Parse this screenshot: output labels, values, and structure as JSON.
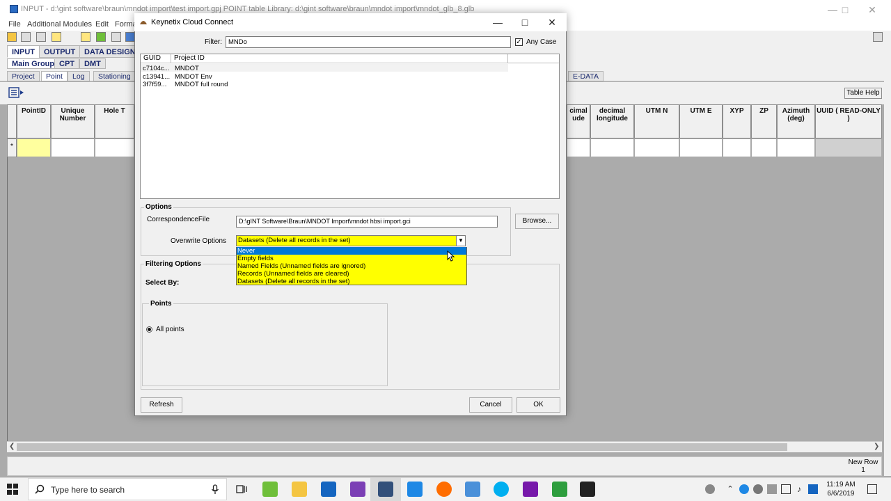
{
  "app": {
    "title": "INPUT - d:\\gint software\\braun\\mndot import\\test import.gpj  POINT table  Library: d:\\gint software\\braun\\mndot import\\mndot_glb_8.glb",
    "menu": [
      "File",
      "Additional Modules",
      "Edit",
      "Forma"
    ],
    "tabs_row1": [
      "INPUT",
      "OUTPUT",
      "DATA DESIGN"
    ],
    "tabs_row2": [
      "Main Group",
      "CPT",
      "DMT"
    ],
    "tabs_row3": [
      "Project",
      "Point",
      "Log",
      "Stationing"
    ],
    "tab_edata": "E-DATA",
    "table_help": "Table Help",
    "row_marker": "*",
    "new_row_label": "New Row 1",
    "columns_left": [
      "PointID",
      "Unique Number",
      "Hole T"
    ],
    "columns_right": [
      "cimal ude",
      "decimal longitude",
      "UTM N",
      "UTM E",
      "XYP",
      "ZP",
      "Azimuth (deg)",
      "UUID ( READ-ONLY )"
    ]
  },
  "dialog": {
    "title": "Keynetix Cloud Connect",
    "filter_label": "Filter:",
    "filter_value": "MNDo",
    "any_case_label": "Any Case",
    "any_case_checked": true,
    "list_headers": [
      "GUID",
      "Project ID"
    ],
    "list_rows": [
      {
        "guid": "c7104c...",
        "project": "MNDOT"
      },
      {
        "guid": "c13941...",
        "project": "MNDOT Env"
      },
      {
        "guid": "3f7f59...",
        "project": "MNDOT full round"
      }
    ],
    "options_title": "Options",
    "correspondence_label": "CorrespondenceFile",
    "correspondence_value": "D:\\gINT Software\\Braun\\MNDOT Import\\mndot hbsi import.gci",
    "browse_label": "Browse...",
    "overwrite_label": "Overwrite Options",
    "overwrite_selected": "Datasets (Delete all records in the set)",
    "overwrite_options": [
      "Never",
      "Empty fields",
      "Named Fields (Unnamed fields are ignored)",
      "Records (Unnamed fields are cleared)",
      "Datasets (Delete all records in the set)"
    ],
    "highlighted_option_index": 0,
    "filtering_title": "Filtering Options",
    "select_by_label": "Select By:",
    "points_title": "Points",
    "all_points_label": "All points",
    "refresh_label": "Refresh",
    "cancel_label": "Cancel",
    "ok_label": "OK"
  },
  "taskbar": {
    "search_placeholder": "Type here to search",
    "time": "11:19 AM",
    "date": "6/6/2019"
  },
  "colors": {
    "highlight_blue": "#0078d7",
    "combo_yellow": "#ffff00",
    "grid_yellow": "#ffff9e"
  }
}
